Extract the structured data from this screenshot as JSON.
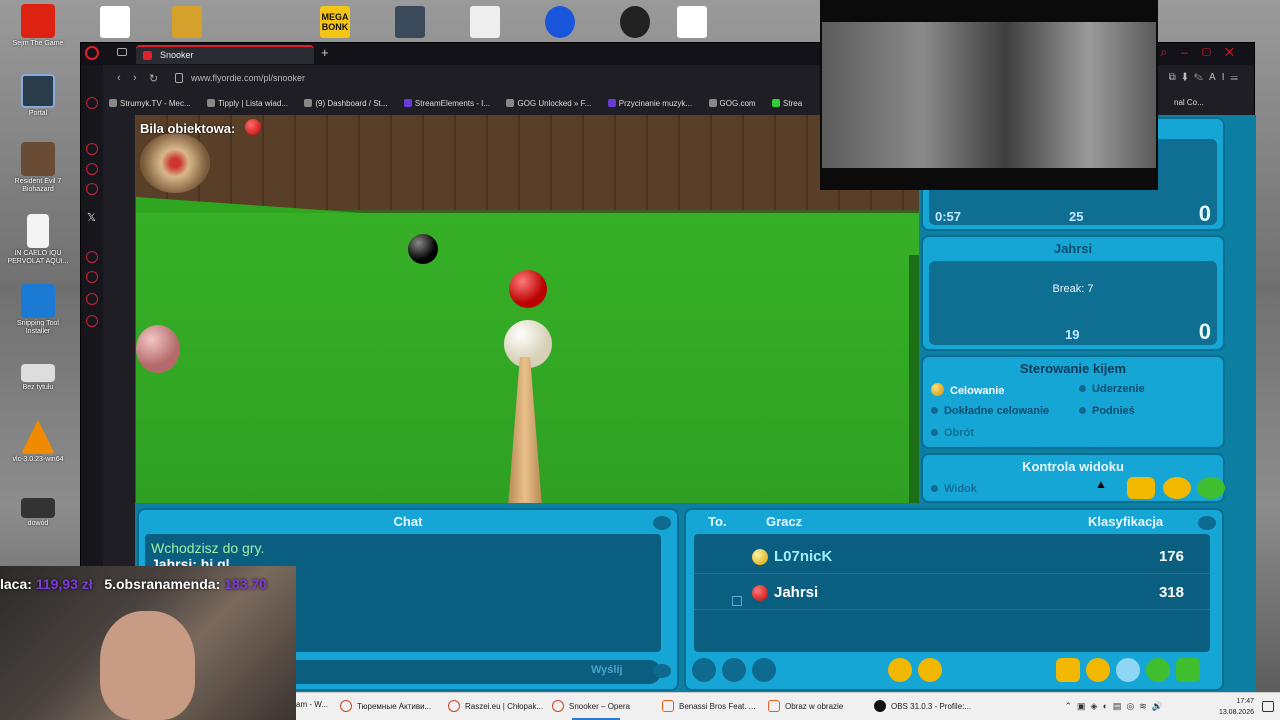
{
  "desktop": {
    "icons": [
      {
        "label": "Sejm The Game",
        "icon": "sejm-game-icon"
      },
      {
        "label": "Portal",
        "icon": "portal-icon"
      },
      {
        "label": "Resident Evil 7 Biohazard",
        "icon": "resident-evil-icon"
      },
      {
        "label": "IN CAELO IQU PERVOLAT AQUI...",
        "icon": "document-icon"
      },
      {
        "label": "Snipping Tool Installer",
        "icon": "download-icon"
      },
      {
        "label": "Bez tytułu",
        "icon": "image-file-icon"
      },
      {
        "label": "vlc-3.0.23-win64",
        "icon": "vlc-icon"
      },
      {
        "label": "dowód",
        "icon": "folder-icon"
      }
    ],
    "top_icons": [
      "file-icon",
      "car-mechanic-icon",
      "mega-bonk-icon",
      "game-icon",
      "file-icon",
      "ea-icon",
      "obs-icon",
      "file-icon"
    ],
    "top_icon_label": "MEGA BONK"
  },
  "browser": {
    "tab_title": "Snooker",
    "url": "www.flyordie.com/pl/snooker",
    "bookmarks": [
      "Strumyk.TV - Mec...",
      "Tipply | Lista wiad...",
      "(9) Dashboard / St...",
      "StreamElements - I...",
      "GOG Unlocked » F...",
      "Przycinanie muzyk...",
      "GOG.com",
      "Strea"
    ],
    "bookmarks_right": "nal Co..."
  },
  "game": {
    "object_ball_label": "Bila obiektowa:",
    "player1": {
      "time": "0:57",
      "score_mid": "25",
      "score_big": "0"
    },
    "player2": {
      "name": "Jahrsi",
      "break_text": "Break: 7",
      "score_mid": "19",
      "score_big": "0"
    },
    "cue_control": {
      "title": "Sterowanie kijem",
      "options": [
        {
          "label": "Celowanie",
          "active": true
        },
        {
          "label": "Uderzenie",
          "active": false
        },
        {
          "label": "Dokładne celowanie",
          "active": false
        },
        {
          "label": "Podnieś",
          "active": false
        },
        {
          "label": "Obrót",
          "active": false
        }
      ]
    },
    "view_control": {
      "title": "Kontrola widoku",
      "view_label": "Widok"
    },
    "chat": {
      "title": "Chat",
      "lines": [
        "Wchodzisz do gry.",
        "Jahrsi: hi gl"
      ],
      "send_label": "Wyślij"
    },
    "ranking": {
      "col_to": "To.",
      "col_player": "Gracz",
      "col_rank": "Klasyfikacja",
      "rows": [
        {
          "name": "L07nicK",
          "score": "176",
          "ball_color": "#f2c200",
          "name_color": "#9ef0ff"
        },
        {
          "name": "Jahrsi",
          "score": "318",
          "ball_color": "#c00000",
          "name_color": "#ffffff"
        }
      ]
    }
  },
  "stream": {
    "donor1_label": "laca:",
    "donor1_amount": "119,93 zł",
    "donor2_label": "5.obsranamenda:",
    "donor2_amount": "183.70"
  },
  "taskbar": {
    "items": [
      {
        "label": "am - W...",
        "icon": "opera-icon"
      },
      {
        "label": "Тюремные Активи...",
        "icon": "opera-icon"
      },
      {
        "label": "Raszei.eu | Chłopak...",
        "icon": "opera-icon"
      },
      {
        "label": "Snooker – Opera",
        "icon": "opera-icon",
        "active": true
      },
      {
        "label": "Benassi Bros Feat. ...",
        "icon": "brave-icon"
      },
      {
        "label": "Obraz w obrazie",
        "icon": "brave-icon"
      },
      {
        "label": "OBS 31.0.3 - Profile:...",
        "icon": "obs-icon"
      }
    ],
    "time": "17:47",
    "date": "13.08.2026"
  },
  "colors": {
    "panel": "#16a6d6",
    "felt": "#36b026",
    "opera_red": "#e0202a"
  }
}
